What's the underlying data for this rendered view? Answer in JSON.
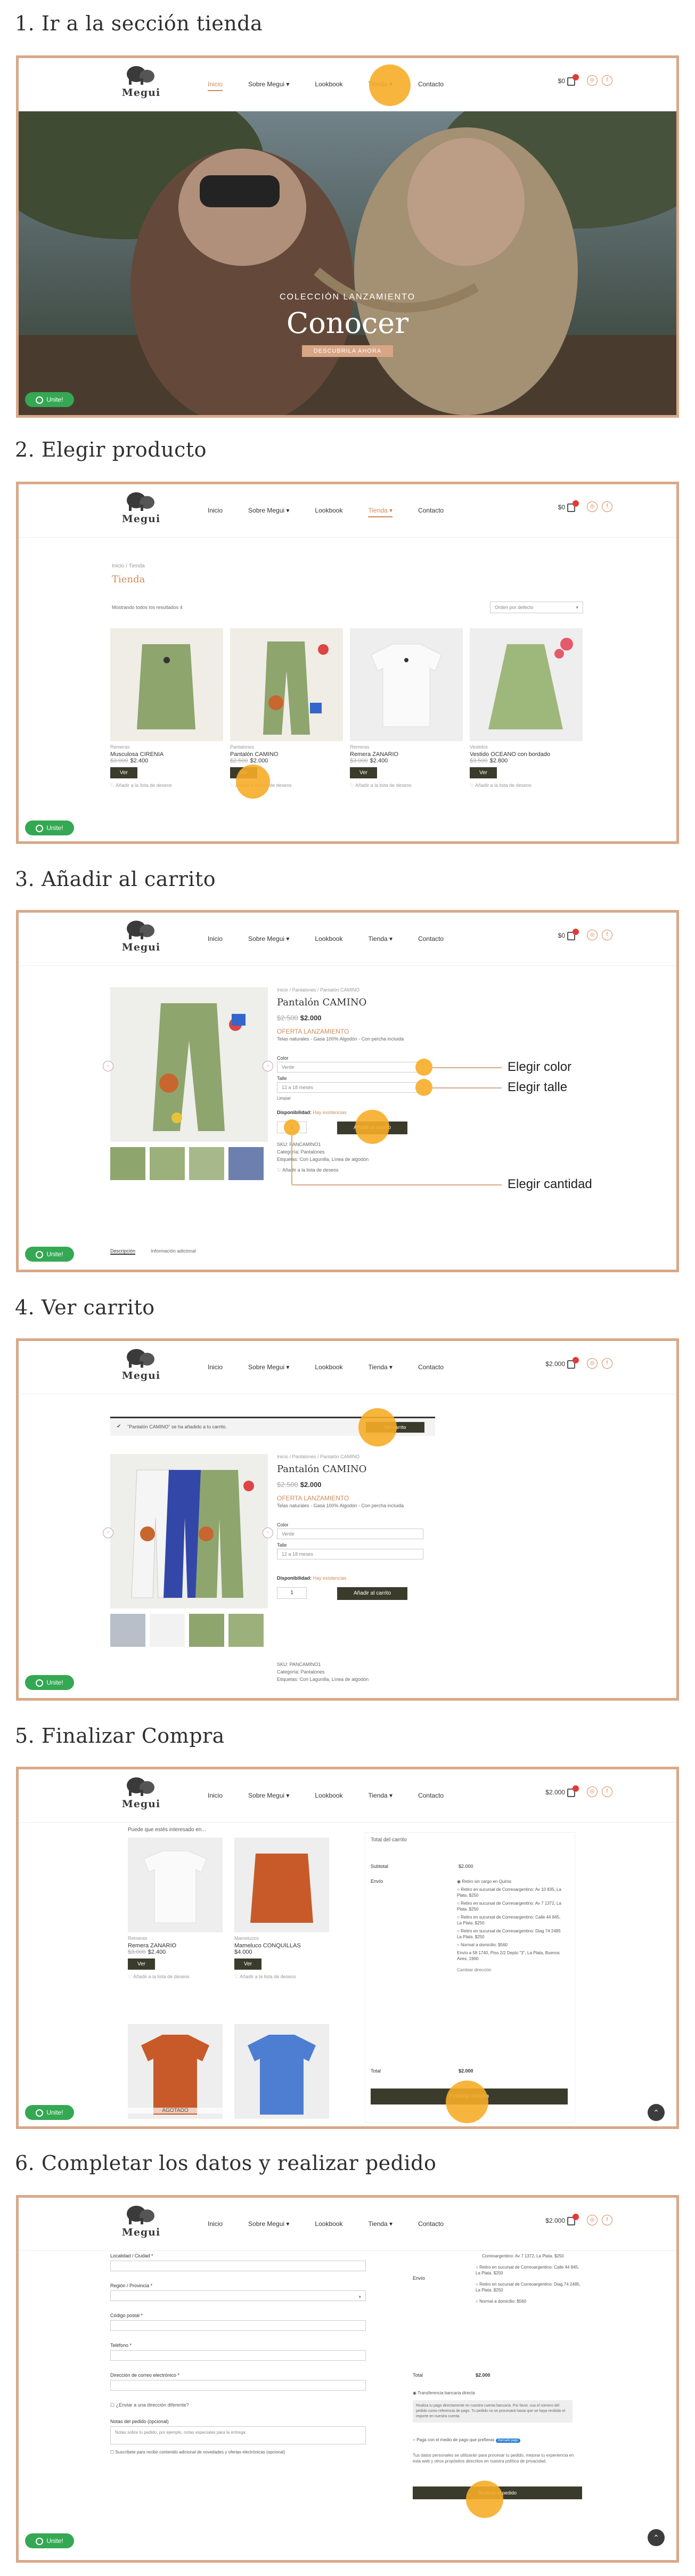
{
  "steps": [
    {
      "title": "1. Ir a la sección tienda"
    },
    {
      "title": "2. Elegir producto"
    },
    {
      "title": "3. Añadir al carrito"
    },
    {
      "title": "4. Ver carrito"
    },
    {
      "title": "5. Finalizar Compra"
    },
    {
      "title": "6. Completar los datos y realizar pedido"
    }
  ],
  "header": {
    "logo_text": "Megui",
    "nav": {
      "inicio": "Inicio",
      "sobre": "Sobre Megui ▾",
      "lookbook": "Lookbook",
      "tienda": "Tienda ▾",
      "contacto": "Contacto"
    },
    "cart_empty": "$0",
    "cart_full": "$2.000",
    "social_ig": "◎",
    "social_fb": "f"
  },
  "whatsapp": "Unite!",
  "hero": {
    "subtitle": "COLECCIÓN LANZAMIENTO",
    "title": "Conocer",
    "button": "DESCUBRILA AHORA"
  },
  "shop": {
    "breadcrumb": "Inicio / Tienda",
    "title": "Tienda",
    "results": "Mostrando todos los resultados 4",
    "sort": "Orden por defecto",
    "products": [
      {
        "cat": "Remeras",
        "name": "Musculosa CIRENIA",
        "price_old": "$3.000",
        "price": "$2.400",
        "button": "Ver",
        "wish": "Añadir a la lista de deseos"
      },
      {
        "cat": "Pantalones",
        "name": "Pantalón CAMINO",
        "price_old": "$2.500",
        "price": "$2.000",
        "button": "Ver",
        "wish": "Añadir a la lista de deseos"
      },
      {
        "cat": "Remeras",
        "name": "Remera ZANARIO",
        "price_old": "$3.000",
        "price": "$2.400",
        "button": "Ver",
        "wish": "Añadir a la lista de deseos"
      },
      {
        "cat": "Vestidos",
        "name": "Vestido OCEANO con bordado",
        "price_old": "$3.500",
        "price": "$2.800",
        "button": "Ver",
        "wish": "Añadir a la lista de deseos"
      }
    ]
  },
  "product": {
    "breadcrumb": "Inicio / Pantalones / Pantalón CAMINO",
    "name": "Pantalón CAMINO",
    "price_old": "$2.500",
    "price": "$2.000",
    "offer": "OFERTA LANZAMIENTO",
    "desc": "Telas naturales - Gasa 100% Algodón - Con percha incluida",
    "color_label": "Color",
    "color_value": "Verde",
    "size_label": "Talle",
    "size_value": "12 a 18 meses",
    "clear": "Limpiar",
    "availability": "Disponibilidad:",
    "stock": "Hay existencias",
    "qty": "1",
    "add": "Añadir al carrito",
    "sku": "SKU: PANCAMINO1",
    "cats": "Categoría: Pantalones",
    "tags": "Etiquetas: Con Lagunilla, Línea de algodón",
    "wish": "Añadir a la lista de deseos",
    "tab1": "Descripción",
    "tab2": "Información adicional"
  },
  "callouts": {
    "color": "Elegir color",
    "size": "Elegir talle",
    "qty": "Elegir cantidad"
  },
  "notice": {
    "text": "\"Pantalón CAMINO\" se ha añadido a tu carrito.",
    "button": "Ver carrito"
  },
  "cart_page": {
    "upsell_title": "Puede que estés interesado en...",
    "upsell": [
      {
        "cat": "Remeras",
        "name": "Remera ZANARIO",
        "price_old": "$3.000",
        "price": "$2.400",
        "button": "Ver",
        "wish": "Añadir a la lista de deseos"
      },
      {
        "cat": "Mamelucos",
        "name": "Mameluco CONQUILLAS",
        "price_old": "",
        "price": "$4.000",
        "button": "Ver",
        "wish": "Añadir a la lista de deseos"
      }
    ],
    "sold_out": "AGOTADO",
    "totals_title": "Total del carrito",
    "subtotal_label": "Subtotal",
    "subtotal": "$2.000",
    "shipping_label": "Envío",
    "options": [
      "Retiro sin cargo en Quirós",
      "Retiro en sucursal de Correoargentino: Av 10 835, La Plata. $250",
      "Retiro en sucursal de Correoargentino: Av 7 1372, La Plata. $250",
      "Retiro en sucursal de Correoargentino: Calle 44 845, La Plata. $250",
      "Retiro en sucursal de Correoargentino: Diag 74 2485 La Plata. $250",
      "Normal a domicilio: $560"
    ],
    "dest": "Envío a 58 1740, Piso 2/2 Depto \"3\", La Plata, Buenos Aires, 1900",
    "change": "Cambiar dirección",
    "total_label": "Total",
    "total": "$2.000",
    "checkout": "Finalizar compra"
  },
  "checkout": {
    "city": "Localidad / Ciudad *",
    "region": "Región / Provincia *",
    "zip": "Código postal *",
    "phone": "Teléfono *",
    "email": "Dirección de correo electrónico *",
    "other": "¿Enviar a una dirección diferente?",
    "notes_label": "Notas del pedido (opcional)",
    "notes_ph": "Notas sobre tu pedido, por ejemplo, notas especiales para la entrega.",
    "subscribe": "Suscríbete para recibir contenido adicional de novedades y ofertas electrónicas (opcional)",
    "ship_options": [
      "Correoargentino: Av 7 1372, La Plata. $250",
      "Retiro en sucursal de Correoargentino: Calle 44 845, La Plata. $250",
      "Retiro en sucursal de Correoargentino: Diag 74 2485, La Plata. $250",
      "Normal a domicilio: $560"
    ],
    "ship_label": "Envío",
    "total_label": "Total",
    "total": "$2.000",
    "transfer": "Transferencia bancaria directa",
    "transfer_note": "Realiza tu pago directamente en nuestra cuenta bancaria. Por favor, usa el número del pedido como referencia de pago. Tu pedido no se procesará hasta que se haya recibido el importe en nuestra cuenta.",
    "mp": "Paga con el medio de pago que prefieras",
    "mp_logo": "mercado pago",
    "privacy": "Tus datos personales se utilizarán para procesar tu pedido, mejorar tu experiencia en esta web y otros propósitos descritos en nuestra política de privacidad.",
    "place": "Realizar el pedido"
  },
  "colors": {
    "accent": "#d08a5a",
    "frame": "#d9a889",
    "dark_button": "#3b3b2c",
    "highlight": "#f6ad28",
    "whatsapp": "#34a853"
  }
}
